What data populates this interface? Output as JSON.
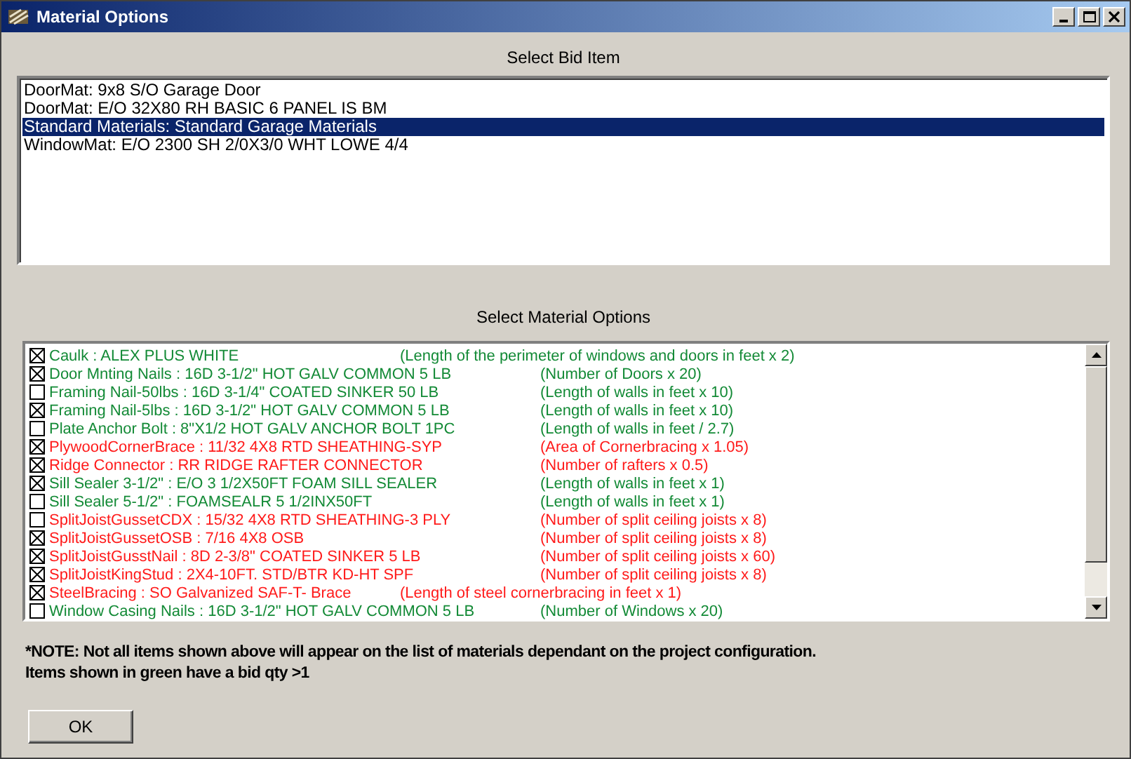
{
  "window": {
    "title": "Material Options"
  },
  "bid_items": {
    "heading": "Select Bid Item",
    "items": [
      {
        "label": "DoorMat: 9x8 S/O Garage Door",
        "selected": false
      },
      {
        "label": "DoorMat: E/O 32X80 RH BASIC 6 PANEL IS BM",
        "selected": false
      },
      {
        "label": "Standard Materials: Standard Garage Materials",
        "selected": true
      },
      {
        "label": "WindowMat: E/O 2300 SH 2/0X3/0 WHT LOWE 4/4",
        "selected": false
      }
    ]
  },
  "material_options": {
    "heading": "Select Material Options",
    "items": [
      {
        "label": "Caulk :  ALEX PLUS WHITE",
        "formula": "(Length of the perimeter of windows and doors in feet x 2)",
        "checked": true,
        "color": "#138a36",
        "kind": "near"
      },
      {
        "label": "Door Mnting Nails : 16D 3-1/2\" HOT GALV COMMON 5 LB",
        "formula": "(Number of Doors x 20)",
        "checked": true,
        "color": "#138a36",
        "kind": "column"
      },
      {
        "label": "Framing Nail-50lbs : 16D 3-1/4\" COATED SINKER 50 LB",
        "formula": "(Length of walls in feet x 10)",
        "checked": false,
        "color": "#138a36",
        "kind": "column"
      },
      {
        "label": "Framing Nail-5lbs : 16D 3-1/2\" HOT GALV COMMON 5 LB",
        "formula": "(Length of walls in feet x 10)",
        "checked": true,
        "color": "#138a36",
        "kind": "column"
      },
      {
        "label": "Plate Anchor Bolt : 8\"X1/2 HOT GALV ANCHOR BOLT 1PC",
        "formula": "(Length of walls in feet / 2.7)",
        "checked": false,
        "color": "#138a36",
        "kind": "column"
      },
      {
        "label": "PlywoodCornerBrace : 11/32  4X8  RTD  SHEATHING-SYP",
        "formula": "(Area of Cornerbracing x 1.05)",
        "checked": true,
        "color": "#ff1a1a",
        "kind": "column"
      },
      {
        "label": "Ridge Connector : RR RIDGE RAFTER CONNECTOR",
        "formula": "(Number of rafters x 0.5)",
        "checked": true,
        "color": "#ff1a1a",
        "kind": "column"
      },
      {
        "label": "Sill Sealer 3-1/2\" : E/O 3 1/2X50FT FOAM SILL SEALER",
        "formula": "(Length of walls in feet x 1)",
        "checked": true,
        "color": "#138a36",
        "kind": "column"
      },
      {
        "label": "Sill Sealer 5-1/2\" : FOAMSEALR 5 1/2INX50FT",
        "formula": "(Length of walls in feet x 1)",
        "checked": false,
        "color": "#138a36",
        "kind": "column"
      },
      {
        "label": "SplitJoistGussetCDX : 15/32  4X8  RTD  SHEATHING-3 PLY",
        "formula": "(Number of split ceiling joists x 8)",
        "checked": false,
        "color": "#ff1a1a",
        "kind": "column"
      },
      {
        "label": "SplitJoistGussetOSB : 7/16  4X8  OSB",
        "formula": "(Number of split ceiling joists x 8)",
        "checked": true,
        "color": "#ff1a1a",
        "kind": "column"
      },
      {
        "label": "SplitJoistGusstNail : 8D 2-3/8\" COATED SINKER 5 LB",
        "formula": "(Number of split ceiling joists x 60)",
        "checked": true,
        "color": "#ff1a1a",
        "kind": "column"
      },
      {
        "label": "SplitJoistKingStud : 2X4-10FT. STD/BTR KD-HT SPF",
        "formula": "(Number of split ceiling joists x 8)",
        "checked": true,
        "color": "#ff1a1a",
        "kind": "column"
      },
      {
        "label": "SteelBracing : SO Galvanized  SAF-T- Brace",
        "formula": "(Length of steel cornerbracing in feet x 1)",
        "checked": true,
        "color": "#ff1a1a",
        "kind": "near"
      },
      {
        "label": "Window Casing Nails : 16D 3-1/2\" HOT GALV COMMON 5 LB",
        "formula": "(Number of Windows x 20)",
        "checked": false,
        "color": "#138a36",
        "kind": "column"
      }
    ]
  },
  "notes": [
    "*NOTE:  Not all items shown above will appear on the list of materials dependant on the project configuration.",
    "Items shown in green have a bid qty >1"
  ],
  "buttons": [
    "OK"
  ]
}
